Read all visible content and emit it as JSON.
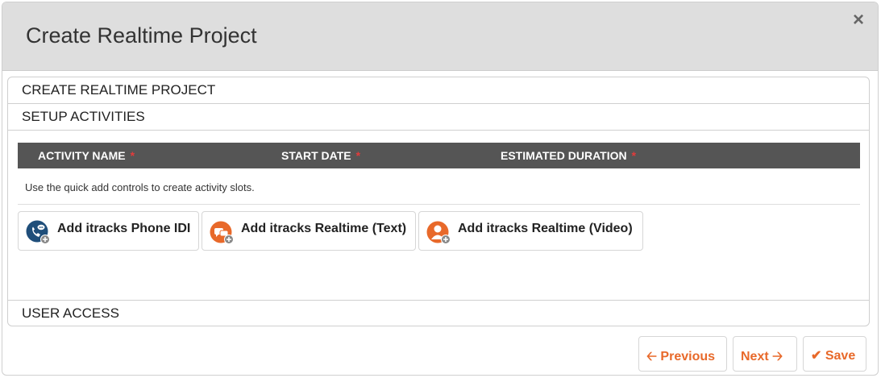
{
  "dialog": {
    "title": "Create Realtime Project",
    "close_label": "×"
  },
  "sections": {
    "create": "CREATE REALTIME PROJECT",
    "setup": "SETUP ACTIVITIES",
    "user_access": "USER ACCESS"
  },
  "table": {
    "columns": [
      "ACTIVITY NAME",
      "START DATE",
      "ESTIMATED DURATION"
    ],
    "required_marker": "*"
  },
  "hint": "Use the quick add controls to create activity slots.",
  "quick_add": [
    {
      "label": "Add itracks Phone IDI",
      "icon": "phone-chat-icon",
      "color": "#1f4e7a"
    },
    {
      "label": "Add itracks Realtime (Text)",
      "icon": "chat-bubbles-icon",
      "color": "#e8692a"
    },
    {
      "label": "Add itracks Realtime (Video)",
      "icon": "person-video-icon",
      "color": "#e8692a"
    }
  ],
  "footer": {
    "previous_label": "Previous",
    "next_label": "Next",
    "save_label": "Save"
  },
  "colors": {
    "accent": "#e8692a",
    "header_bg": "#dedede",
    "table_head_bg": "#555555",
    "required": "#e23b3b"
  }
}
